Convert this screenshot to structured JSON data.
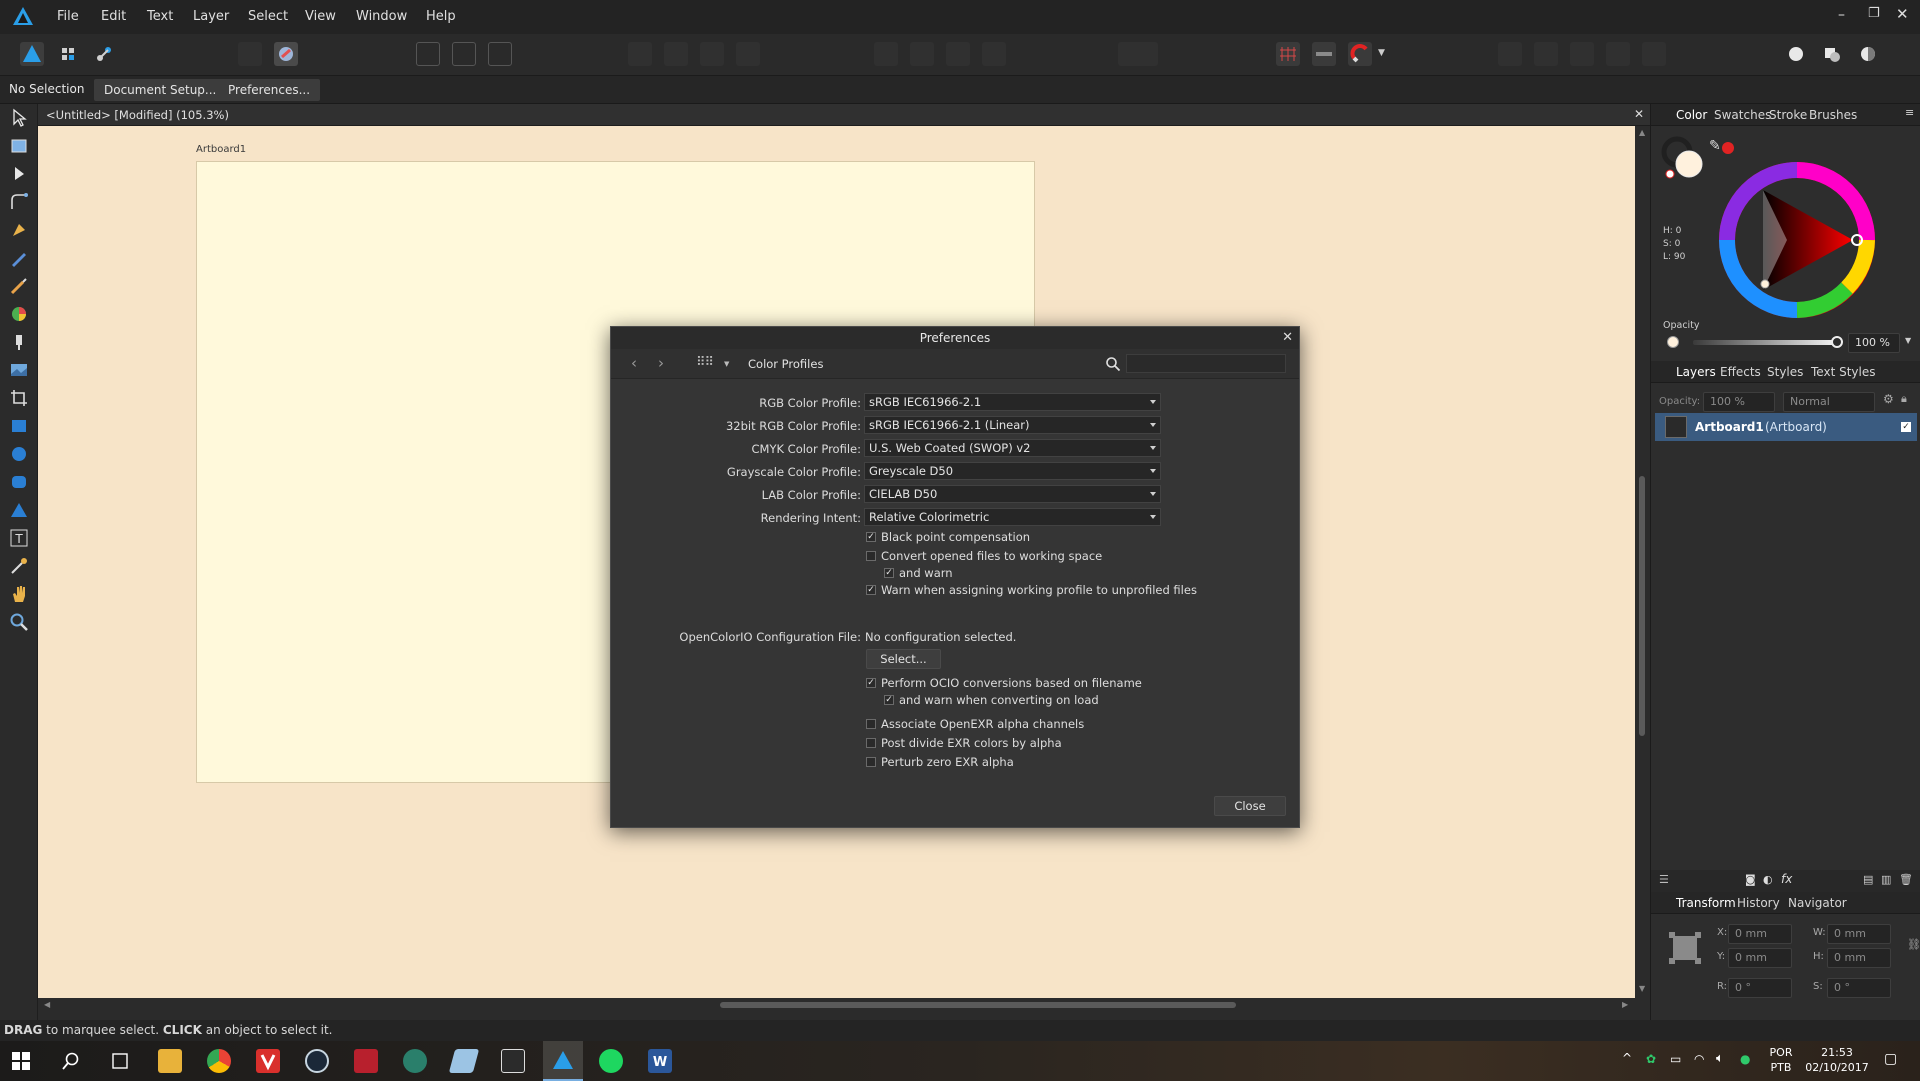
{
  "menu": [
    "File",
    "Edit",
    "Text",
    "Layer",
    "Select",
    "View",
    "Window",
    "Help"
  ],
  "context_bar": {
    "selection": "No Selection",
    "doc_setup": "Document Setup...",
    "preferences": "Preferences..."
  },
  "document": {
    "tab_title": "<Untitled> [Modified] (105.3%)",
    "artboard_label": "Artboard1"
  },
  "color_panel": {
    "tabs": [
      "Color",
      "Swatches",
      "Stroke",
      "Brushes"
    ],
    "h": "H: 0",
    "s": "S: 0",
    "l": "L: 90",
    "opacity_label": "Opacity",
    "opacity_value": "100 %",
    "accent": "#e12323"
  },
  "layers_panel": {
    "tabs": [
      "Layers",
      "Effects",
      "Styles",
      "Text Styles"
    ],
    "opacity_label": "Opacity:",
    "opacity_value": "100 %",
    "blend": "Normal",
    "layer_name": "Artboard1",
    "layer_type": "(Artboard)"
  },
  "transform_panel": {
    "tabs": [
      "Transform",
      "History",
      "Navigator"
    ],
    "x_label": "X:",
    "x": "0 mm",
    "y_label": "Y:",
    "y": "0 mm",
    "w_label": "W:",
    "w": "0 mm",
    "h_label": "H:",
    "h": "0 mm",
    "r_label": "R:",
    "r": "0 °",
    "s_label": "S:",
    "s": "0 °"
  },
  "status_bar": {
    "drag": "DRAG",
    "drag_text": " to marquee select. ",
    "click": "CLICK",
    "click_text": " an object to select it."
  },
  "taskbar": {
    "lang1": "POR",
    "lang2": "PTB",
    "time": "21:53",
    "date": "02/10/2017"
  },
  "dialog": {
    "title": "Preferences",
    "section": "Color Profiles",
    "rows": [
      {
        "label": "RGB Color Profile:",
        "value": "sRGB IEC61966-2.1"
      },
      {
        "label": "32bit RGB Color Profile:",
        "value": "sRGB IEC61966-2.1 (Linear)"
      },
      {
        "label": "CMYK Color Profile:",
        "value": "U.S. Web Coated (SWOP) v2"
      },
      {
        "label": "Grayscale Color Profile:",
        "value": "Greyscale D50"
      },
      {
        "label": "LAB Color Profile:",
        "value": "CIELAB D50"
      },
      {
        "label": "Rendering Intent:",
        "value": "Relative Colorimetric"
      }
    ],
    "checks": [
      {
        "label": "Black point compensation",
        "checked": true
      },
      {
        "label": "Convert opened files to working space",
        "checked": false
      },
      {
        "label": "and warn",
        "checked": true
      },
      {
        "label": "Warn when assigning working profile to unprofiled files",
        "checked": true
      }
    ],
    "ocio_label": "OpenColorIO Configuration File:",
    "ocio_value": "No configuration selected.",
    "select_btn": "Select...",
    "ocio_checks": [
      {
        "label": "Perform OCIO conversions based on filename",
        "checked": true
      },
      {
        "label": "and warn when converting on load",
        "checked": true
      },
      {
        "label": "Associate OpenEXR alpha channels",
        "checked": false
      },
      {
        "label": "Post divide EXR colors by alpha",
        "checked": false
      },
      {
        "label": "Perturb zero EXR alpha",
        "checked": false
      }
    ],
    "close_btn": "Close"
  }
}
